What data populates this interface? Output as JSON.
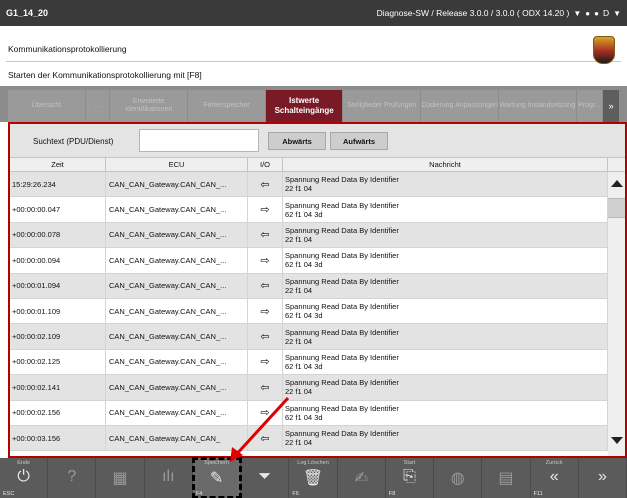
{
  "titlebar": {
    "title": "G1_14_20",
    "status": "Diagnose-SW / Release 3.0.0 / 3.0.0  ( ODX  14.20 )",
    "right_letter": "D"
  },
  "header": {
    "title": "Kommunikationsprotokollierung",
    "subtitle": "Starten der Kommunikationsprotokollierung mit [F8]"
  },
  "tabs": [
    {
      "label": "Übersicht"
    },
    {
      "label": "..."
    },
    {
      "label": "Erweiterte Identifikationen"
    },
    {
      "label": "Fehlerspeicher"
    },
    {
      "label": "Istwerte Schalteingänge"
    },
    {
      "label": "Stellglieder Prüfungen"
    },
    {
      "label": "Codierung Anpassungen"
    },
    {
      "label": "Wartung Instandsetzung"
    },
    {
      "label": "Progr..."
    },
    {
      "label": "»"
    }
  ],
  "search": {
    "label": "Suchtext (PDU/Dienst)",
    "value": "",
    "btn_down": "Abwärts",
    "btn_up": "Aufwärts"
  },
  "table": {
    "columns": [
      "Zeit",
      "ECU",
      "I/O",
      "Nachricht"
    ],
    "rows": [
      {
        "time": "15:29:26.234",
        "ecu": "CAN_CAN_Gateway.CAN_CAN_...",
        "io": "⇦",
        "msg1": "Spannung Read Data By Identifier",
        "msg2": "22 f1 04"
      },
      {
        "time": "+00:00:00.047",
        "ecu": "CAN_CAN_Gateway.CAN_CAN_...",
        "io": "⇨",
        "msg1": "Spannung Read Data By Identifier",
        "msg2": "62 f1 04 3d"
      },
      {
        "time": "+00:00:00.078",
        "ecu": "CAN_CAN_Gateway.CAN_CAN_...",
        "io": "⇦",
        "msg1": "Spannung Read Data By Identifier",
        "msg2": "22 f1 04"
      },
      {
        "time": "+00:00:00.094",
        "ecu": "CAN_CAN_Gateway.CAN_CAN_...",
        "io": "⇨",
        "msg1": "Spannung Read Data By Identifier",
        "msg2": "62 f1 04 3d"
      },
      {
        "time": "+00:00:01.094",
        "ecu": "CAN_CAN_Gateway.CAN_CAN_...",
        "io": "⇦",
        "msg1": "Spannung Read Data By Identifier",
        "msg2": "22 f1 04"
      },
      {
        "time": "+00:00:01.109",
        "ecu": "CAN_CAN_Gateway.CAN_CAN_...",
        "io": "⇨",
        "msg1": "Spannung Read Data By Identifier",
        "msg2": "62 f1 04 3d"
      },
      {
        "time": "+00:00:02.109",
        "ecu": "CAN_CAN_Gateway.CAN_CAN_...",
        "io": "⇦",
        "msg1": "Spannung Read Data By Identifier",
        "msg2": "22 f1 04"
      },
      {
        "time": "+00:00:02.125",
        "ecu": "CAN_CAN_Gateway.CAN_CAN_...",
        "io": "⇨",
        "msg1": "Spannung Read Data By Identifier",
        "msg2": "62 f1 04 3d"
      },
      {
        "time": "+00:00:02.141",
        "ecu": "CAN_CAN_Gateway.CAN_CAN_...",
        "io": "⇦",
        "msg1": "Spannung Read Data By Identifier",
        "msg2": "22 f1 04"
      },
      {
        "time": "+00:00:02.156",
        "ecu": "CAN_CAN_Gateway.CAN_CAN_...",
        "io": "⇨",
        "msg1": "Spannung Read Data By Identifier",
        "msg2": "62 f1 04 3d"
      },
      {
        "time": "+00:00:03.156",
        "ecu": "CAN_CAN_Gateway.CAN_CAN_",
        "io": "⇦",
        "msg1": "Spannung Read Data By Identifier",
        "msg2": "22 f1 04"
      }
    ]
  },
  "toolbar": [
    {
      "label": "Ende",
      "key": "ESC",
      "icon": "⏻",
      "bright": true
    },
    {
      "label": "",
      "key": "",
      "icon": "?",
      "bright": false
    },
    {
      "label": "",
      "key": "",
      "icon": "▦",
      "bright": false
    },
    {
      "label": "",
      "key": "",
      "icon": "ılı",
      "bright": false
    },
    {
      "label": "Speichern",
      "key": "F4",
      "icon": "✎",
      "bright": true
    },
    {
      "label": "",
      "key": "",
      "icon": "⏷",
      "bright": true
    },
    {
      "label": "Log Löschen",
      "key": "F6",
      "icon": "🗑",
      "bright": true
    },
    {
      "label": "",
      "key": "",
      "icon": "✍",
      "bright": false
    },
    {
      "label": "Start",
      "key": "F8",
      "icon": "⎘",
      "bright": true
    },
    {
      "label": "",
      "key": "",
      "icon": "◍",
      "bright": false
    },
    {
      "label": "",
      "key": "",
      "icon": "▤",
      "bright": false
    },
    {
      "label": "Zurück",
      "key": "F11",
      "icon": "«",
      "bright": true
    },
    {
      "label": "",
      "key": "",
      "icon": "»",
      "bright": true
    }
  ],
  "colors": {
    "accent": "#7a1a27",
    "highlight_frame": "#b30000",
    "annotation_arrow": "#e00000"
  }
}
